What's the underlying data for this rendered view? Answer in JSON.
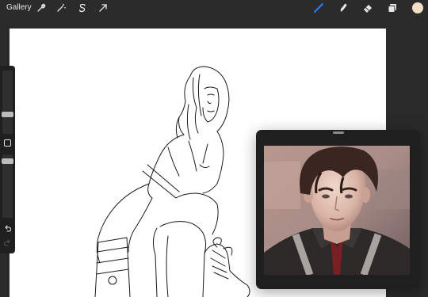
{
  "topbar": {
    "gallery_label": "Gallery",
    "left_tools": [
      "wrench-icon",
      "magic-wand-icon",
      "selection-s-icon",
      "transform-arrow-icon"
    ],
    "right_tools": [
      "brush-icon",
      "smudge-icon",
      "eraser-icon",
      "layers-icon",
      "color-swatch"
    ],
    "active_tool": "brush-icon",
    "accent_color": "#2f7bff",
    "current_color": "#f2dfc4"
  },
  "sidebar": {
    "brush_size_level": 0.25,
    "opacity_level": 0.15,
    "buttons": [
      "modify-button",
      "undo-icon",
      "redo-icon"
    ]
  },
  "canvas": {
    "background": "#ffffff",
    "content": "line-art-sketch"
  },
  "reference_window": {
    "content": "reference-portrait-photo"
  }
}
